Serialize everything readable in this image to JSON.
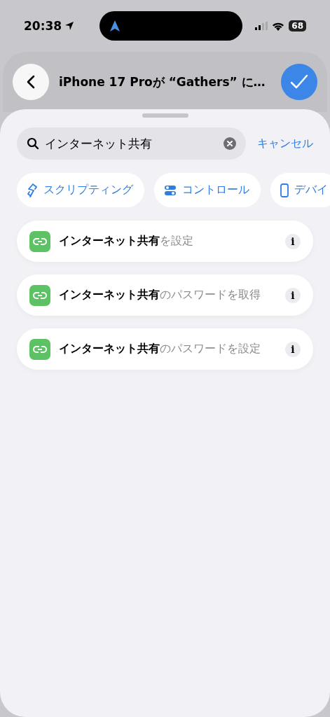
{
  "status_bar": {
    "time": "20:38",
    "battery": "68"
  },
  "header": {
    "title": "iPhone 17 Proが “Gathers” に…"
  },
  "search": {
    "value": "インターネット共有",
    "cancel": "キャンセル"
  },
  "categories": [
    {
      "kind": "scripting",
      "label": "スクリプティング"
    },
    {
      "kind": "controls",
      "label": "コントロール"
    },
    {
      "kind": "device",
      "label": "デバイ"
    }
  ],
  "results": [
    {
      "text": "**インターネット共有**を設定",
      "info": "i"
    },
    {
      "text": "**インターネット共有**のパスワードを取得",
      "info": "i"
    },
    {
      "text": "**インターネット共有**のパスワードを設定",
      "info": "i"
    }
  ]
}
